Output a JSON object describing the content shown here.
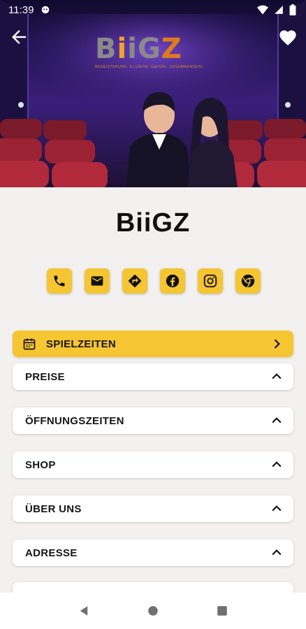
{
  "status_bar": {
    "time": "11:39"
  },
  "hero": {
    "logo_text": "BiiGZ",
    "logo_tagline": "BEGEISTERUNG. ILLUSION. GEFÜHL. ZUSAMMENSEIN."
  },
  "venue": {
    "name": "BiiGZ"
  },
  "contact_buttons": [
    "phone-icon",
    "email-icon",
    "directions-icon",
    "facebook-icon",
    "instagram-icon",
    "website-icon"
  ],
  "sections": [
    {
      "label": "SPIELZEITEN",
      "icon": "calendar-icon",
      "highlight": true,
      "chevron": "right"
    },
    {
      "label": "PREISE",
      "chevron": "up"
    },
    {
      "label": "ÖFFNUNGSZEITEN",
      "chevron": "up"
    },
    {
      "label": "SHOP",
      "chevron": "up"
    },
    {
      "label": "ÜBER UNS",
      "chevron": "up"
    },
    {
      "label": "ADRESSE",
      "chevron": "up"
    }
  ],
  "colors": {
    "accent": "#f6c532",
    "background": "#f2f1ef",
    "logo_orange": "#e0892a"
  }
}
